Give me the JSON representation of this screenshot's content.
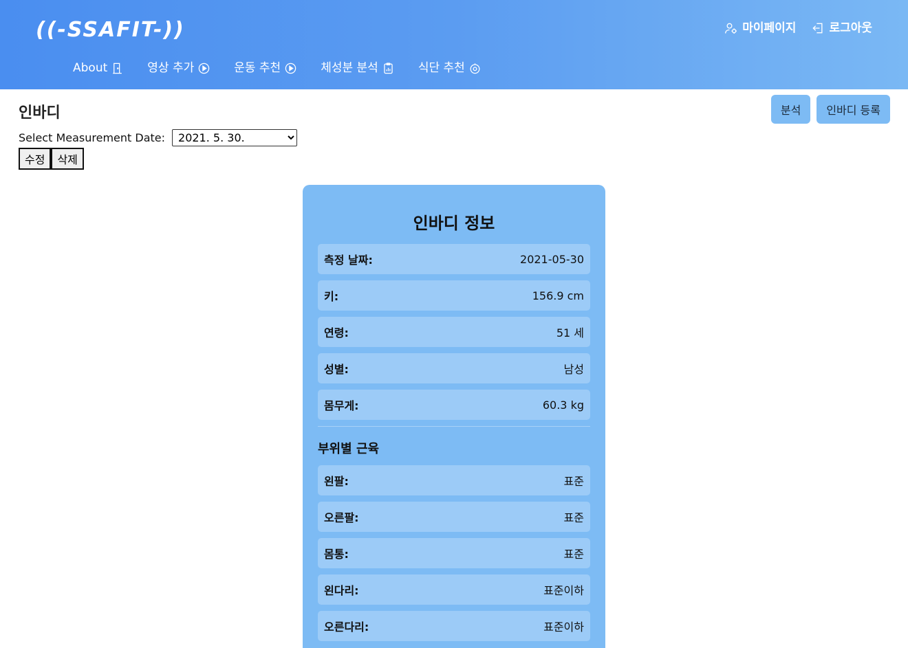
{
  "header": {
    "logo": "((-SSAFIT-))",
    "top_links": [
      {
        "label": "마이페이지",
        "icon": "user-gear-icon"
      },
      {
        "label": "로그아웃",
        "icon": "logout-icon"
      }
    ],
    "nav": [
      {
        "label": "About",
        "icon": "door-icon"
      },
      {
        "label": "영상 추가",
        "icon": "play-circle-icon"
      },
      {
        "label": "운동 추천",
        "icon": "play-circle-icon"
      },
      {
        "label": "체성분 분석",
        "icon": "clipboard-chart-icon"
      },
      {
        "label": "식단 추천",
        "icon": "fruit-icon"
      }
    ]
  },
  "page": {
    "title": "인바디",
    "actions": {
      "analyze": "분석",
      "register": "인바디 등록"
    },
    "date_label": "Select Measurement Date:",
    "date_selected": "2021. 5. 30.",
    "edit_label": "수정",
    "delete_label": "삭제"
  },
  "card": {
    "title": "인바디 정보",
    "info": [
      {
        "label": "측정 날짜:",
        "value": "2021-05-30"
      },
      {
        "label": "키:",
        "value": "156.9 cm"
      },
      {
        "label": "연령:",
        "value": "51 세"
      },
      {
        "label": "성별:",
        "value": "남성"
      },
      {
        "label": "몸무게:",
        "value": "60.3 kg"
      }
    ],
    "section_title": "부위별 근육",
    "muscle": [
      {
        "label": "왼팔:",
        "value": "표준"
      },
      {
        "label": "오른팔:",
        "value": "표준"
      },
      {
        "label": "몸통:",
        "value": "표준"
      },
      {
        "label": "왼다리:",
        "value": "표준이하"
      },
      {
        "label": "오른다리:",
        "value": "표준이하"
      }
    ]
  },
  "colors": {
    "header_start": "#4a8ef0",
    "header_end": "#7ab8f4",
    "card_bg": "#7dbbf4",
    "row_bg": "#9ccbf7"
  }
}
